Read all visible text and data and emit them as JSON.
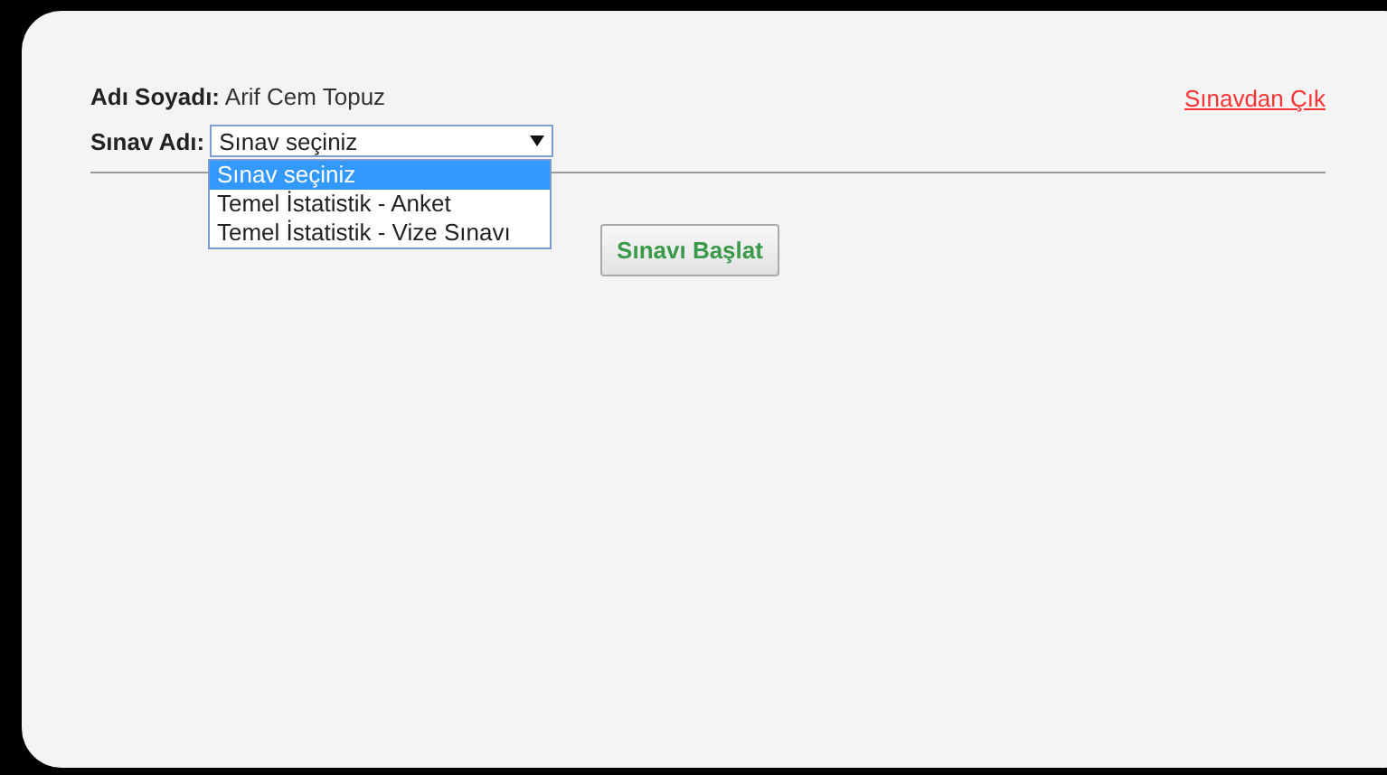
{
  "user": {
    "label": "Adı Soyadı:",
    "value": "Arif Cem Topuz"
  },
  "logout_link": "Sınavdan Çık",
  "exam": {
    "label": "Sınav Adı:",
    "value": "Sınav seçiniz",
    "expanded": true,
    "options": [
      {
        "label": "Sınav seçiniz",
        "selected": true
      },
      {
        "label": "Temel İstatistik - Anket",
        "selected": false
      },
      {
        "label": "Temel İstatistik - Vize Sınavı",
        "selected": false
      }
    ]
  },
  "start_button": "Sınavı Başlat"
}
